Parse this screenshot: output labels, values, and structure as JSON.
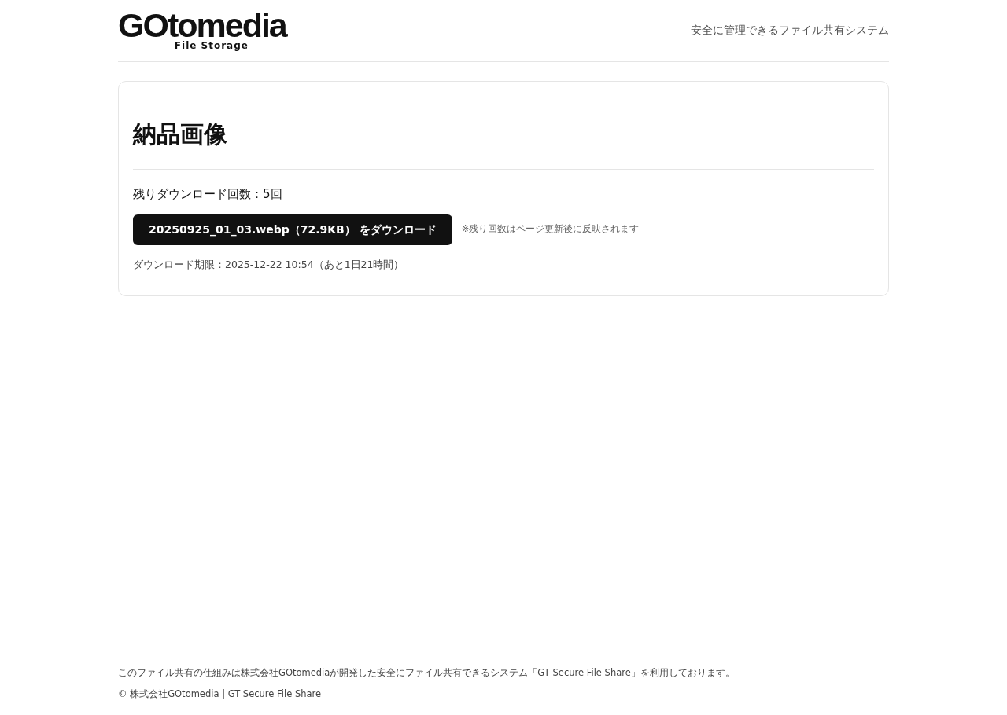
{
  "header": {
    "logo": {
      "name": "GOtomedia",
      "subtitle": "File Storage"
    },
    "tagline": "安全に管理できるファイル共有システム"
  },
  "card": {
    "title": "納品画像",
    "remaining": "残りダウンロード回数：5回",
    "download_button": "20250925_01_03.webp（72.9KB） をダウンロード",
    "note": "※残り回数はページ更新後に反映されます",
    "deadline": "ダウンロード期限：2025-12-22 10:54（あと1日21時間）"
  },
  "footer": {
    "description": "このファイル共有の仕組みは株式会社GOtomediaが開発した安全にファイル共有できるシステム「GT Secure File Share」を利用しております。",
    "copyright": "© 株式会社GOtomedia | GT Secure File Share"
  }
}
